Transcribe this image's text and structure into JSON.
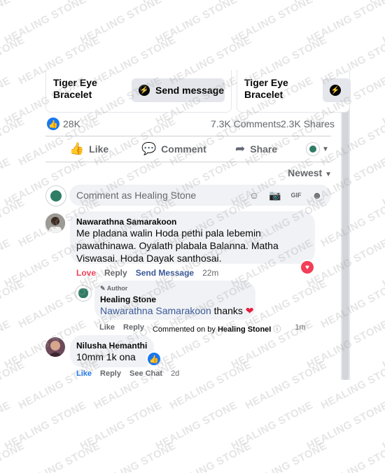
{
  "watermark": "HEALING STONE",
  "colors": {
    "primary": "#1877f2",
    "love": "#f33e58",
    "meta_gray": "#65676b"
  },
  "cards": [
    {
      "title_line1": "Tiger Eye",
      "title_line2": "Bracelet",
      "button": "Send message",
      "button_icon": "messenger-icon"
    },
    {
      "title_line1": "Tiger Eye",
      "title_line2": "Bracelet",
      "button_icon": "messenger-icon"
    }
  ],
  "stats": {
    "likes": "28K",
    "comments": "7.3K Comments",
    "shares": "2.3K Shares"
  },
  "actions": {
    "like": "Like",
    "comment": "Comment",
    "share": "Share"
  },
  "sort": {
    "label": "Newest"
  },
  "composer": {
    "placeholder": "Comment as Healing Stone"
  },
  "comments": [
    {
      "author": "Nawarathna Samarakoon",
      "text": "Me pladana walin Hoda pethi pala lebemin pawathinawa. Oyalath plabala Balanna. Matha Viswasai. Hoda Dayak santhosai.",
      "love": "Love",
      "reply": "Reply",
      "send": "Send Message",
      "time": "22m",
      "reaction": "heart-icon"
    },
    {
      "badge": "Author",
      "author": "Healing Stone",
      "mention": "Nawarathna Samarakoon",
      "text": "thanks",
      "like": "Like",
      "reply": "Reply",
      "commented_on_by": "Commented on by",
      "commented_by_name": "Healing StoneI",
      "time": "1m"
    },
    {
      "author": "Nilusha Hemanthi",
      "text": "10mm 1k ona",
      "like": "Like",
      "reply": "Reply",
      "see_chat": "See Chat",
      "time": "2d",
      "reaction": "like-icon"
    }
  ]
}
